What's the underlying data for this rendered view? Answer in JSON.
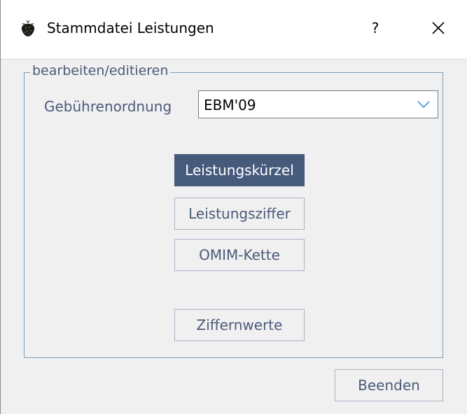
{
  "window": {
    "title": "Stammdatei Leistungen",
    "help_label": "?"
  },
  "group": {
    "legend": "bearbeiten/editieren",
    "gebuehrenordnung_label": "Gebührenordnung",
    "gebuehrenordnung_value": "EBM'09"
  },
  "buttons": {
    "leistungskuerzel": "Leistungskürzel",
    "leistungsziffer": "Leistungsziffer",
    "omim_kette": "OMIM-Kette",
    "ziffernwerte": "Ziffernwerte",
    "beenden": "Beenden"
  },
  "colors": {
    "accent": "#465a7c",
    "text": "#4c5a7a",
    "groupbox_border": "#7f9db9",
    "dropdown_arrow": "#4a90d9"
  },
  "icons": {
    "app": "strawberry-icon",
    "close": "close-icon",
    "dropdown": "chevron-down-icon"
  }
}
